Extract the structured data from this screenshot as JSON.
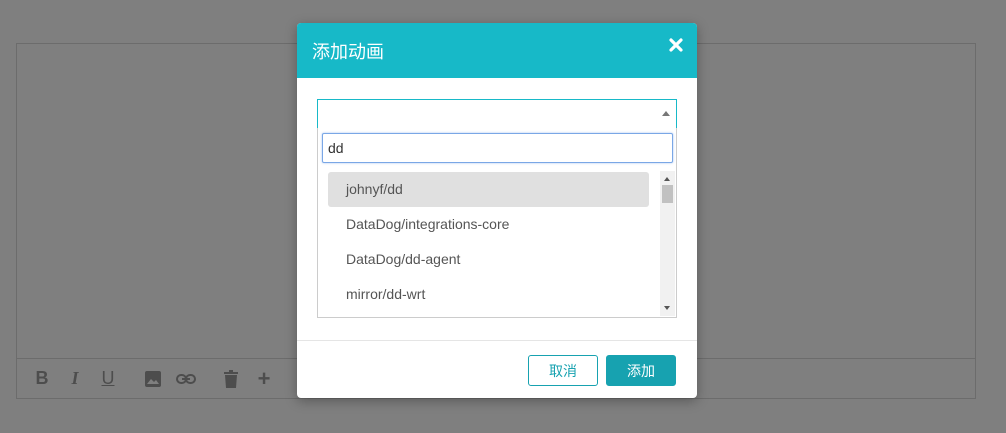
{
  "toolbar": {
    "items": [
      "bold-icon",
      "italic-icon",
      "underline-icon",
      "image-icon",
      "link-icon",
      "trash-icon",
      "plus-icon"
    ],
    "bold": "B",
    "italic": "I",
    "underline": "U",
    "plus": "+"
  },
  "modal": {
    "title": "添加动画",
    "search_value": "dd",
    "options": [
      "johnyf/dd",
      "DataDog/integrations-core",
      "DataDog/dd-agent",
      "mirror/dd-wrt"
    ],
    "highlighted_index": 0,
    "cancel_label": "取消",
    "add_label": "添加",
    "accent_color": "#17b9c8",
    "button_color": "#17a2b0"
  }
}
